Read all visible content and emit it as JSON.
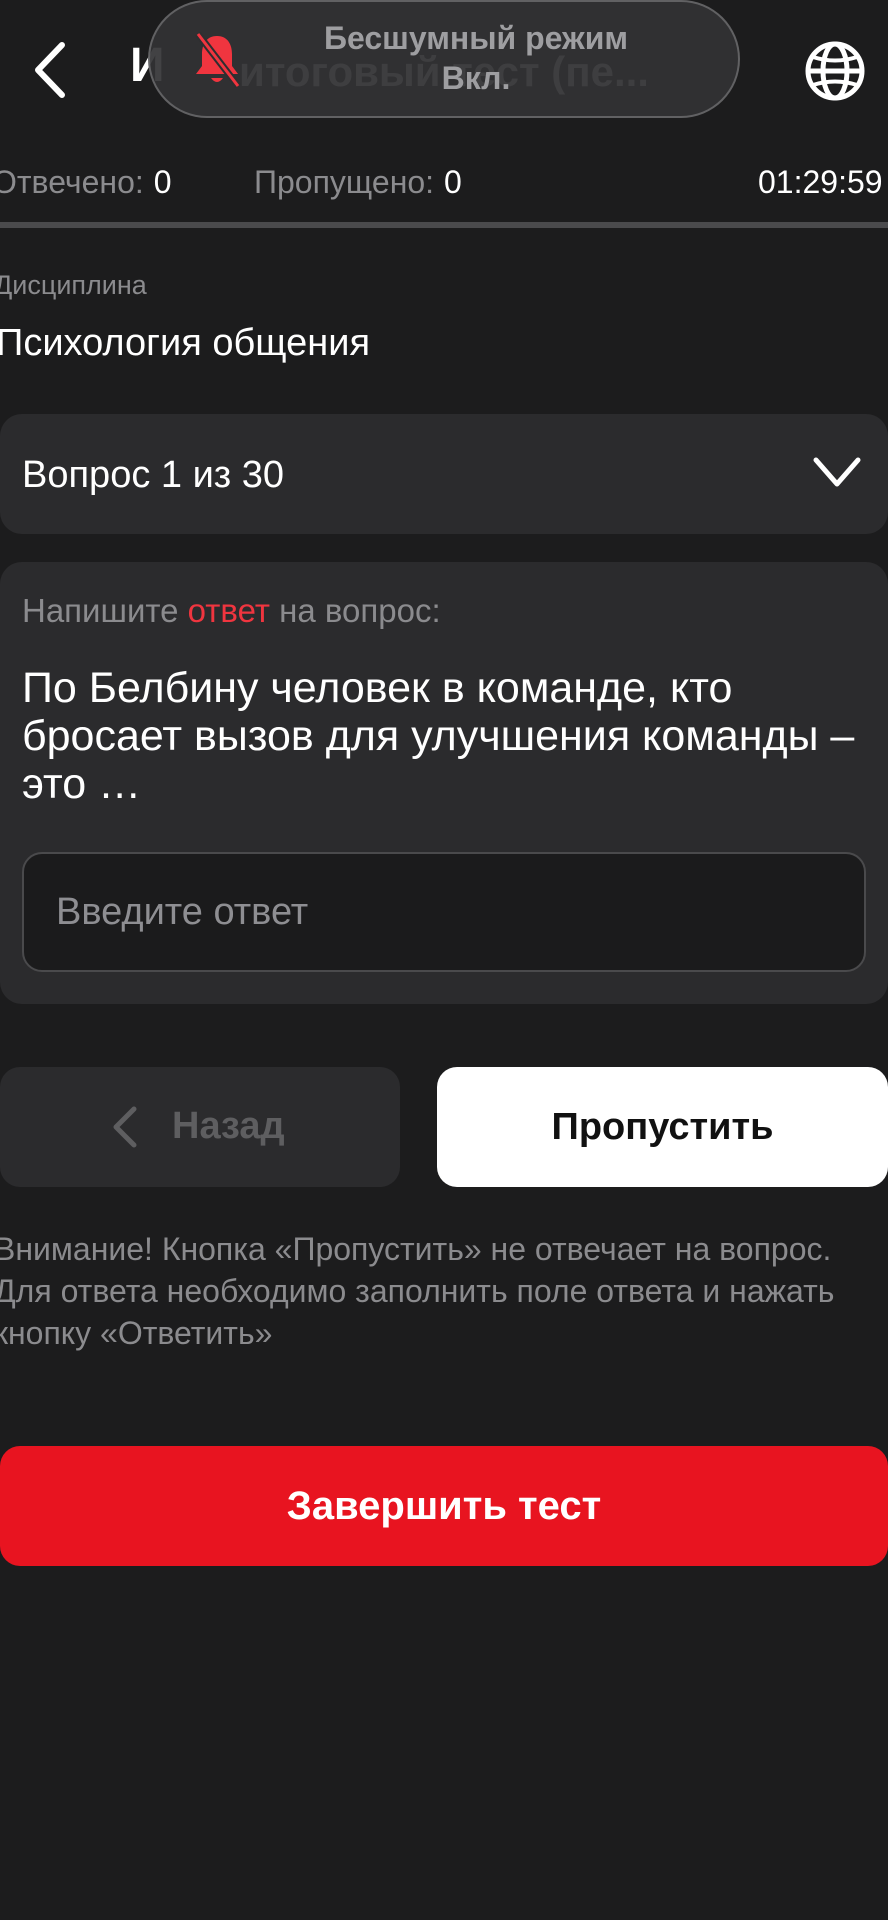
{
  "header": {
    "title_visible_fragment": "И",
    "back_icon": "chevron-left-icon",
    "language_icon": "globe-icon"
  },
  "toast": {
    "icon": "bell-off-icon",
    "title": "Бесшумный режим",
    "status": "Вкл.",
    "ghost_text": "итоговый тест (пе..."
  },
  "stats": {
    "answered_label": "Отвечено:",
    "answered_value": "0",
    "skipped_label": "Пропущено:",
    "skipped_value": "0",
    "timer": "01:29:59"
  },
  "discipline": {
    "label": "Дисциплина",
    "value": "Психология общения"
  },
  "question_selector": {
    "label": "Вопрос 1 из 30",
    "icon": "chevron-down-icon"
  },
  "question": {
    "instruction_before": "Напишите ",
    "instruction_accent": "ответ",
    "instruction_after": " на вопрос:",
    "text": "По Белбину человек в команде, кто бросает вызов для улучшения команды – это …",
    "answer_placeholder": "Введите ответ",
    "answer_value": ""
  },
  "navigation": {
    "back_label": "Назад",
    "skip_label": "Пропустить"
  },
  "warning": "Внимание! Кнопка «Пропустить» не отвечает на вопрос. Для ответа необходимо заполнить поле ответа и нажать кнопку «Ответить»",
  "finish_label": "Завершить тест",
  "colors": {
    "background": "#1c1c1d",
    "card": "#2b2b2d",
    "accent_red": "#e81420",
    "muted_text": "#8b8b8e"
  }
}
